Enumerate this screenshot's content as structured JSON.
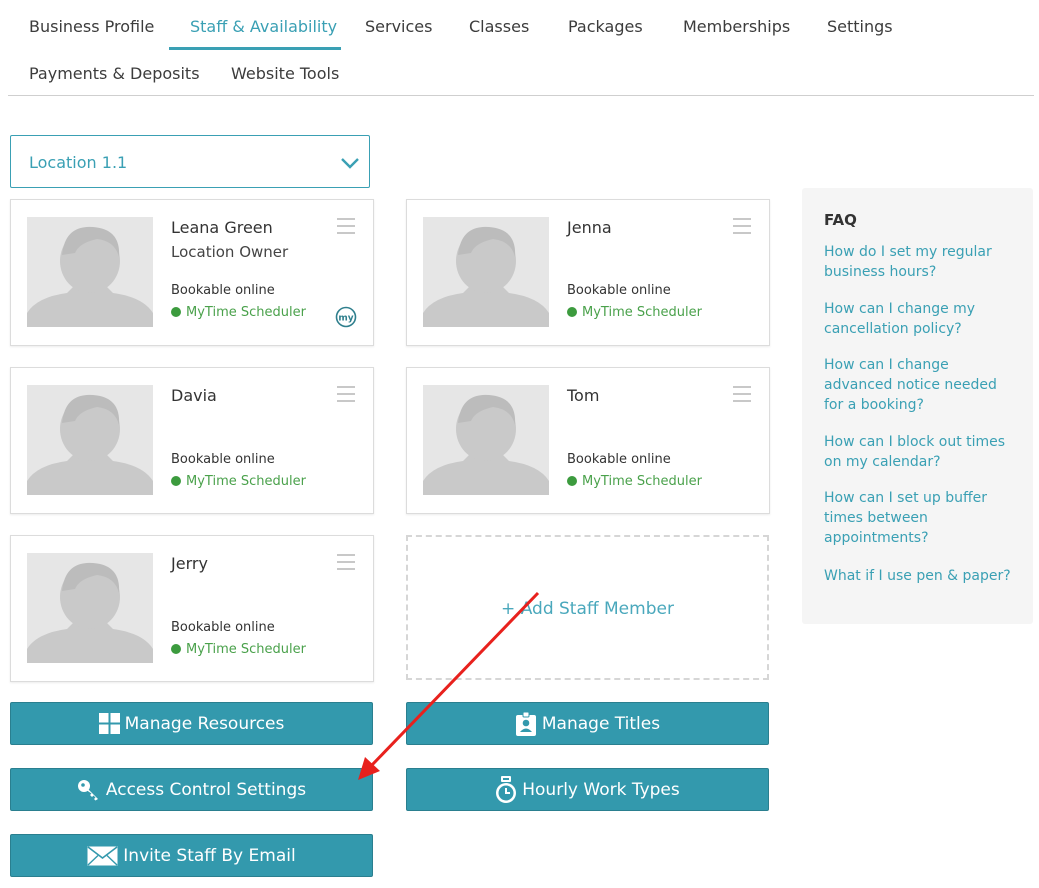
{
  "tabs": [
    {
      "label": "Business Profile"
    },
    {
      "label": "Staff & Availability"
    },
    {
      "label": "Services"
    },
    {
      "label": "Classes"
    },
    {
      "label": "Packages"
    },
    {
      "label": "Memberships"
    },
    {
      "label": "Settings"
    },
    {
      "label": "Payments & Deposits"
    },
    {
      "label": "Website Tools"
    }
  ],
  "active_tab": "Staff & Availability",
  "location": {
    "selected": "Location 1.1"
  },
  "staff": [
    {
      "name": "Leana Green",
      "role": "Location Owner",
      "bookable": "Bookable online",
      "scheduler": "MyTime Scheduler"
    },
    {
      "name": "Jenna",
      "bookable": "Bookable online",
      "scheduler": "MyTime Scheduler"
    },
    {
      "name": "Davia",
      "bookable": "Bookable online",
      "scheduler": "MyTime Scheduler"
    },
    {
      "name": "Tom",
      "bookable": "Bookable online",
      "scheduler": "MyTime Scheduler"
    },
    {
      "name": "Jerry",
      "bookable": "Bookable online",
      "scheduler": "MyTime Scheduler"
    }
  ],
  "add_staff_label": "+ Add Staff Member",
  "buttons": {
    "manage_resources": "Manage Resources",
    "manage_titles": "Manage Titles",
    "access_control": "Access Control Settings",
    "hourly_work_types": "Hourly Work Types",
    "invite_staff": "Invite Staff By Email"
  },
  "faq": {
    "title": "FAQ",
    "links": [
      "How do I set my regular business hours?",
      "How can I change my cancellation policy?",
      "How can I change advanced notice needed for a booking?",
      "How can I block out times on my calendar?",
      "How can I set up buffer times between appointments?",
      "What if I use pen & paper?"
    ]
  },
  "colors": {
    "accent": "#3aa0b4",
    "button": "#3399ad",
    "status_green": "#3c9b3e",
    "annotation_arrow": "#e8211d"
  },
  "icons": {
    "location_select": "chevron-down-icon",
    "card_menu": "hamburger-menu-icon",
    "owner_badge": "mytime-logo-icon",
    "manage_resources": "grid-icon",
    "manage_titles": "id-badge-icon",
    "access_control": "key-icon",
    "hourly_work_types": "clock-clipboard-icon",
    "invite_staff": "envelope-icon"
  }
}
